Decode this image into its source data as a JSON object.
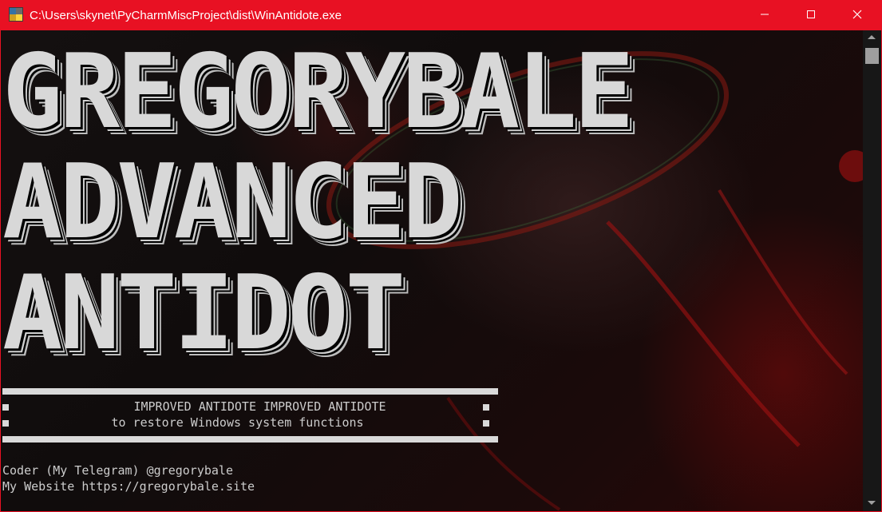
{
  "window": {
    "title": "C:\\Users\\skynet\\PyCharmMiscProject\\dist\\WinAntidote.exe",
    "accent_color": "#e81123",
    "icon": "python-exe-icon",
    "controls": {
      "minimize_icon": "minimize-icon",
      "maximize_icon": "maximize-icon",
      "close_icon": "close-icon"
    }
  },
  "console": {
    "banner_lines": [
      "GREGORYBALE",
      "ADVANCED",
      "ANTIDOT"
    ],
    "box": {
      "line1": "IMPROVED ANTIDOTE IMPROVED ANTIDOTE",
      "line2": "to restore Windows system functions"
    },
    "info": {
      "coder": "Coder (My Telegram) @gregorybale",
      "website": "My Website https://gregorybale.site"
    }
  }
}
